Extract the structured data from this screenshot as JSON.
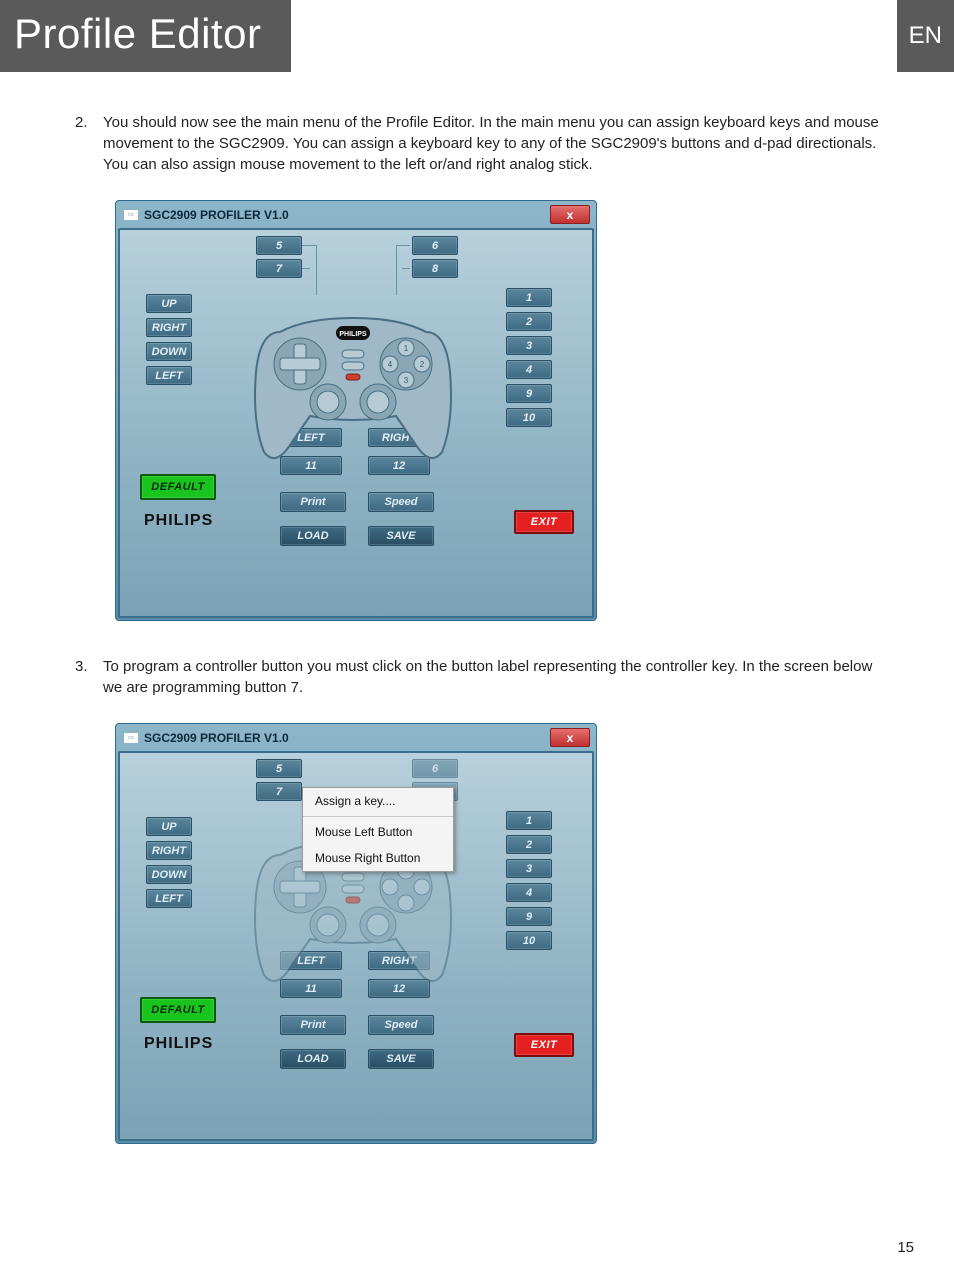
{
  "header": {
    "title": "Profile Editor",
    "lang": "EN"
  },
  "steps": {
    "s2": {
      "num": "2.",
      "text": "You should now see the main menu of the Profile Editor. In the main menu you can assign keyboard keys and mouse movement to the SGC2909. You can assign a keyboard key to any of the SGC2909's buttons and d-pad directionals. You can also assign mouse movement to the left or/and right analog stick."
    },
    "s3": {
      "num": "3.",
      "text": "To program a controller button you must click on the button label representing the controller key. In the screen below we are programming button 7."
    }
  },
  "profiler": {
    "title": "SGC2909 PROFILER V1.0",
    "close": "x",
    "dpad": {
      "up": "UP",
      "right": "RIGHT",
      "down": "DOWN",
      "left": "LEFT"
    },
    "shoulders": {
      "l1": "5",
      "l2": "7",
      "r1": "6",
      "r2": "8"
    },
    "face": {
      "b1": "1",
      "b2": "2",
      "b3": "3",
      "b4": "4",
      "b9": "9",
      "b10": "10"
    },
    "sticks": {
      "left": "LEFT",
      "right": "RIGHT",
      "b11": "11",
      "b12": "12"
    },
    "actions": {
      "default": "DEFAULT",
      "print": "Print",
      "speed": "Speed",
      "load": "LOAD",
      "save": "SAVE",
      "exit": "EXIT"
    },
    "logo": "PHILIPS",
    "badge": "PHILIPS"
  },
  "context_menu": {
    "assign": "Assign a key....",
    "mlb": "Mouse Left Button",
    "mrb": "Mouse Right Button"
  },
  "page_number": "15"
}
